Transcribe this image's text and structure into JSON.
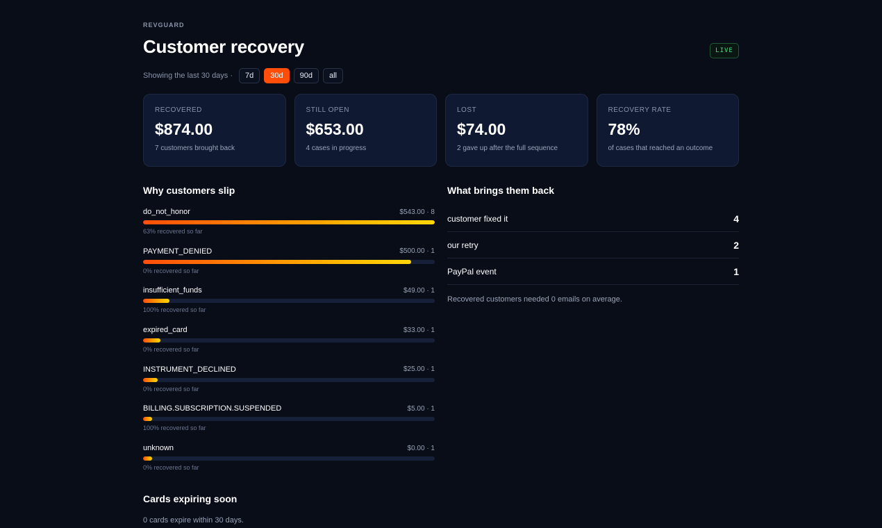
{
  "brand": "REVGUARD",
  "title": "Customer recovery",
  "live_badge": "LIVE",
  "filters": {
    "label": "Showing the last 30 days ·",
    "options": [
      "7d",
      "30d",
      "90d",
      "all"
    ],
    "selected": "30d"
  },
  "stats": [
    {
      "label": "RECOVERED",
      "value": "$874.00",
      "sub": "7 customers brought back"
    },
    {
      "label": "STILL OPEN",
      "value": "$653.00",
      "sub": "4 cases in progress"
    },
    {
      "label": "LOST",
      "value": "$74.00",
      "sub": "2 gave up after the full sequence"
    },
    {
      "label": "RECOVERY RATE",
      "value": "78%",
      "sub": "of cases that reached an outcome"
    }
  ],
  "reasons": {
    "title": "Why customers slip",
    "items": [
      {
        "name": "do_not_honor",
        "meta": "$543.00 · 8",
        "fill": 1.0,
        "note": "63% recovered so far"
      },
      {
        "name": "PAYMENT_DENIED",
        "meta": "$500.00 · 1",
        "fill": 0.92,
        "note": "0% recovered so far"
      },
      {
        "name": "insufficient_funds",
        "meta": "$49.00 · 1",
        "fill": 0.09,
        "note": "100% recovered so far"
      },
      {
        "name": "expired_card",
        "meta": "$33.00 · 1",
        "fill": 0.06,
        "note": "0% recovered so far"
      },
      {
        "name": "INSTRUMENT_DECLINED",
        "meta": "$25.00 · 1",
        "fill": 0.05,
        "note": "0% recovered so far"
      },
      {
        "name": "BILLING.SUBSCRIPTION.SUSPENDED",
        "meta": "$5.00 · 1",
        "fill": 0.03,
        "note": "100% recovered so far"
      },
      {
        "name": "unknown",
        "meta": "$0.00 · 1",
        "fill": 0.03,
        "note": "0% recovered so far"
      }
    ]
  },
  "brings_back": {
    "title": "What brings them back",
    "items": [
      {
        "label": "customer fixed it",
        "count": "4"
      },
      {
        "label": "our retry",
        "count": "2"
      },
      {
        "label": "PayPal event",
        "count": "1"
      }
    ],
    "note": "Recovered customers needed 0 emails on average."
  },
  "expiring": {
    "title": "Cards expiring soon",
    "note": "0 cards expire within 30 days."
  },
  "colors": {
    "background": "#090d18",
    "accent": "#ff4d0a",
    "card": "#0f1a32",
    "live": "#4ade80"
  }
}
